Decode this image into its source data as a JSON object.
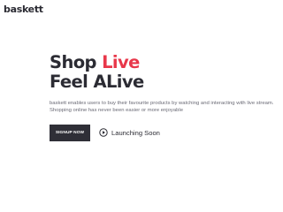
{
  "header": {
    "logo_text": "baskett"
  },
  "hero": {
    "line1_prefix": "Shop ",
    "line1_accent": "Live",
    "line2": "Feel ALive",
    "description": "baskett enables users to buy their favourite products by watching and interacting with live stream. Shopping online has never been easier or more enjoyable",
    "signup_label": "SIGNUP NOW",
    "launch_label": "Launching Soon",
    "launch_icon": "play-circle-icon"
  },
  "colors": {
    "accent": "#e8374a",
    "dark": "#2b2b33",
    "button_bg": "#2f2f37",
    "muted_text": "#6b6b76"
  }
}
